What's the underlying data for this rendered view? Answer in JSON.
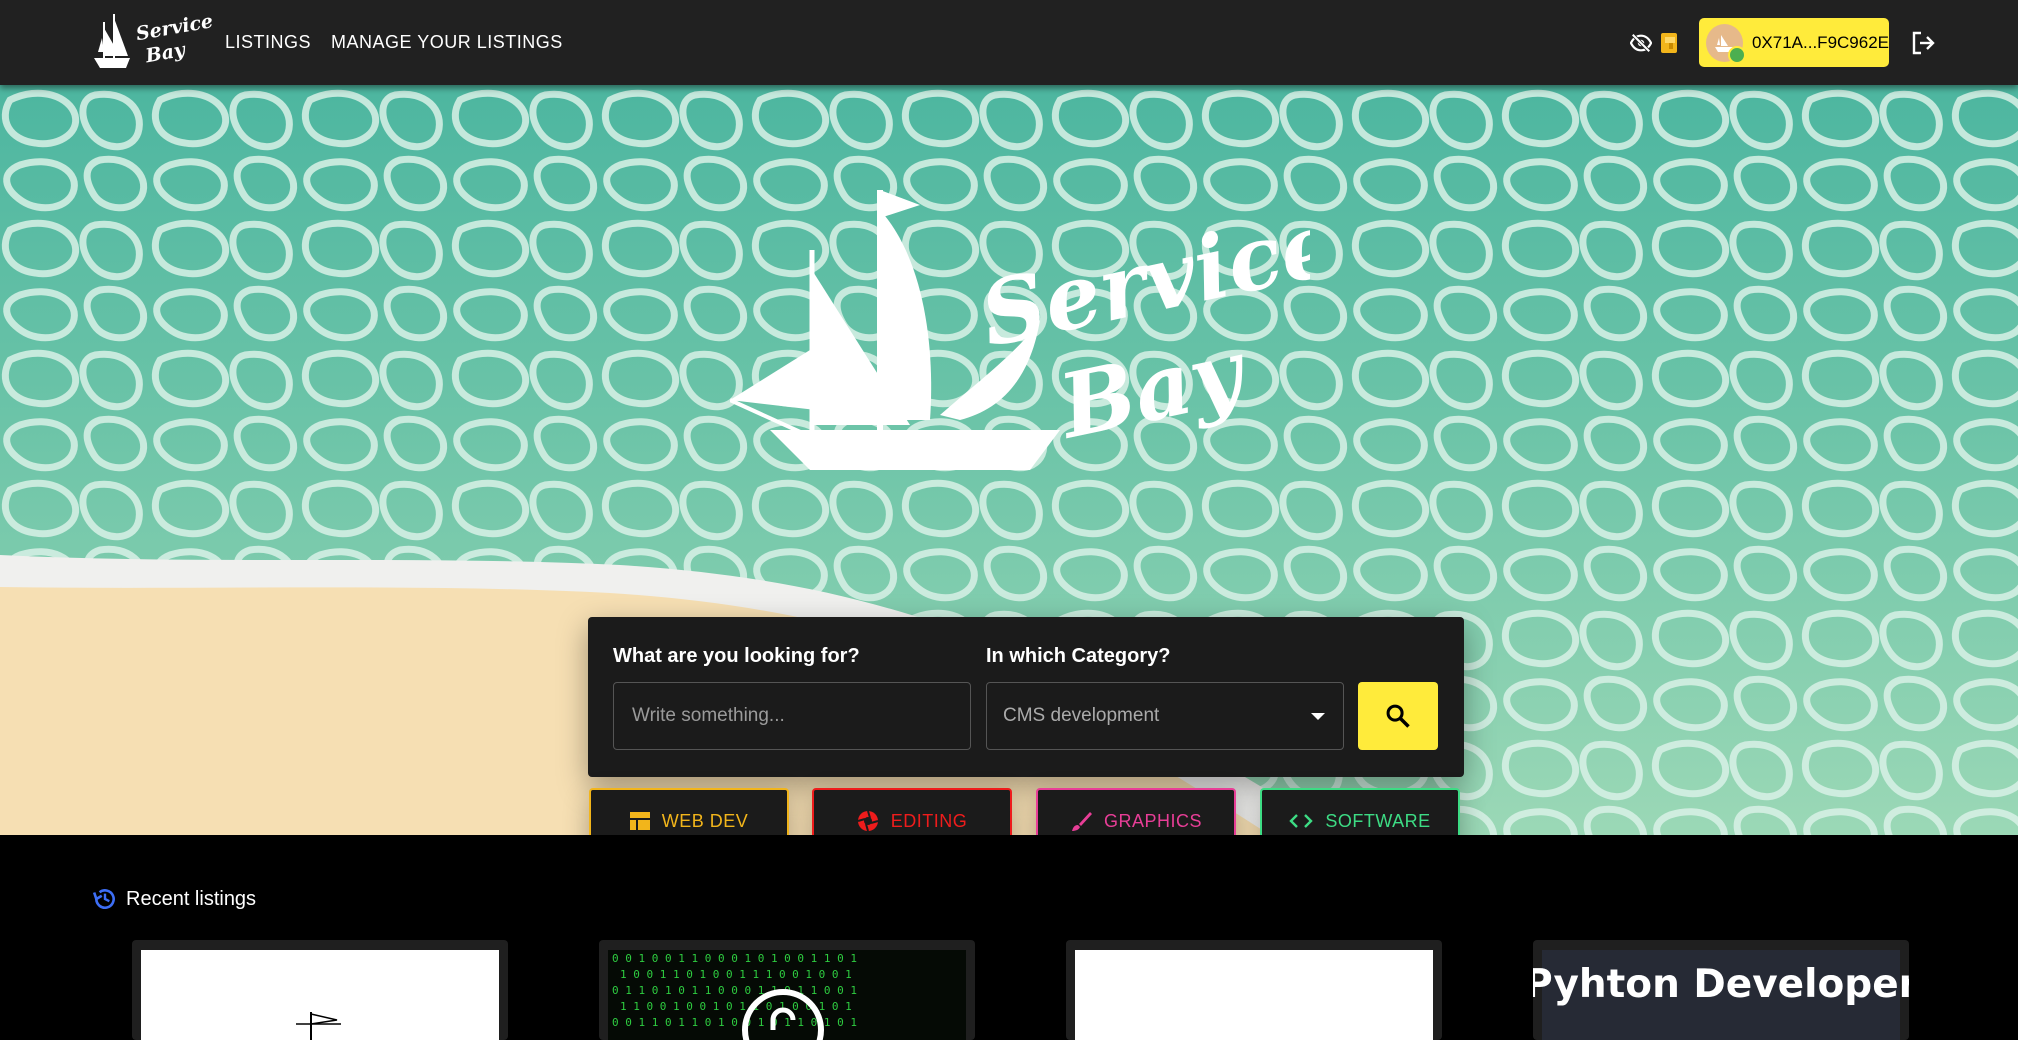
{
  "header": {
    "nav": [
      "LISTINGS",
      "MANAGE YOUR LISTINGS"
    ],
    "wallet_address": "0X71A...F9C962E",
    "colors": {
      "bar": "#212121",
      "wallet": "#ffeb3b"
    }
  },
  "search": {
    "query_label": "What are you looking for?",
    "query_placeholder": "Write something...",
    "category_label": "In which Category?",
    "category_value": "CMS development"
  },
  "categories": [
    {
      "label": "WEB DEV",
      "color": "#f2b51b",
      "icon": "dashboard-icon"
    },
    {
      "label": "EDITING",
      "color": "#ef1c1c",
      "icon": "aperture-icon"
    },
    {
      "label": "GRAPHICS",
      "color": "#e83e97",
      "icon": "brush-icon"
    },
    {
      "label": "SOFTWARE",
      "color": "#3ddc84",
      "icon": "code-icon"
    }
  ],
  "recent": {
    "title": "Recent listings",
    "cards": [
      {
        "caption": ""
      },
      {
        "caption": ""
      },
      {
        "caption": ""
      },
      {
        "caption": "Pyhton Developer"
      }
    ]
  }
}
